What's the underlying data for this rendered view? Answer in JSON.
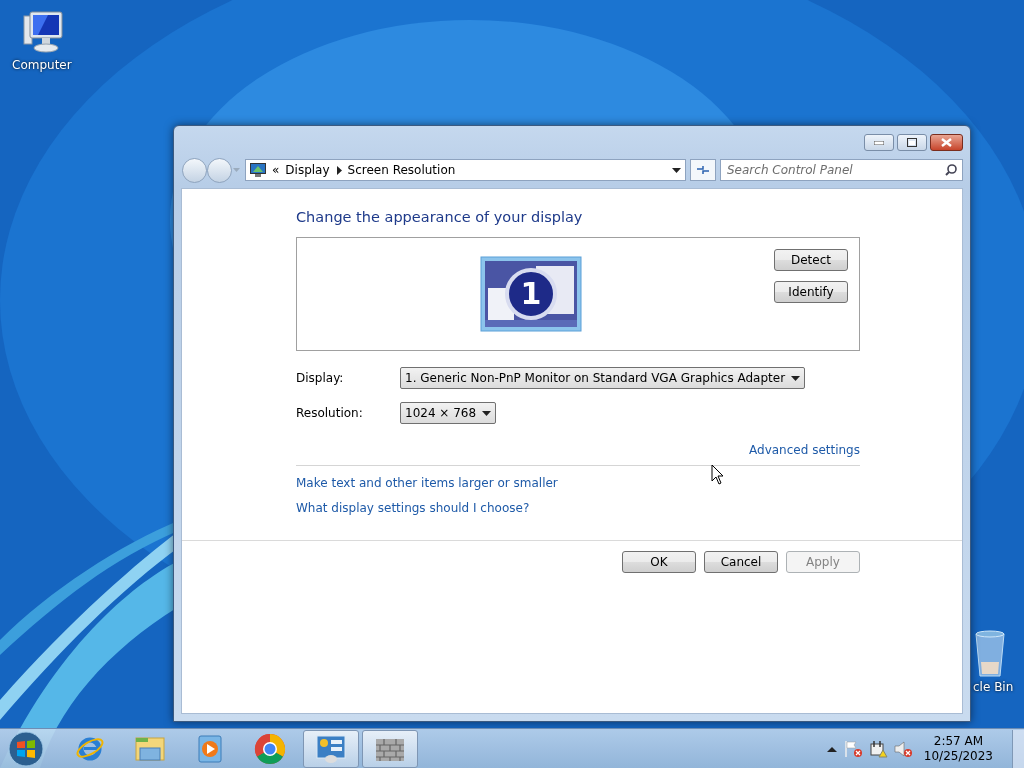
{
  "desktop_icons": [
    {
      "kind": "computer",
      "label": "Computer"
    },
    {
      "kind": "recycle-bin",
      "label": "cle Bin"
    }
  ],
  "window": {
    "breadcrumb": [
      "Display",
      "Screen Resolution"
    ],
    "breadcrumb_prefix": "«",
    "search": {
      "placeholder": "Search Control Panel"
    },
    "heading": "Change the appearance of your display",
    "monitor_number": "1",
    "side_buttons": [
      {
        "label": "Detect",
        "disabled": false
      },
      {
        "label": "Identify",
        "disabled": false
      }
    ],
    "fields": [
      {
        "label": "Display:",
        "value": "1. Generic Non-PnP Monitor on Standard VGA Graphics Adapter"
      },
      {
        "label": "Resolution:",
        "value": "1024 × 768"
      }
    ],
    "advanced_link": "Advanced settings",
    "links": [
      "Make text and other items larger or smaller",
      "What display settings should I choose?"
    ],
    "buttons": [
      {
        "label": "OK",
        "disabled": false
      },
      {
        "label": "Cancel",
        "disabled": false
      },
      {
        "label": "Apply",
        "disabled": true
      }
    ]
  },
  "taskbar": {
    "apps": [
      {
        "kind": "ie",
        "open": false
      },
      {
        "kind": "folder",
        "open": false
      },
      {
        "kind": "media",
        "open": false
      },
      {
        "kind": "chrome",
        "open": false
      },
      {
        "kind": "display",
        "open": true
      },
      {
        "kind": "wall",
        "open": true
      }
    ],
    "tray": [
      {
        "kind": "flag"
      },
      {
        "kind": "network"
      },
      {
        "kind": "speaker"
      }
    ],
    "time": "2:57 AM",
    "date": "10/25/2023"
  }
}
